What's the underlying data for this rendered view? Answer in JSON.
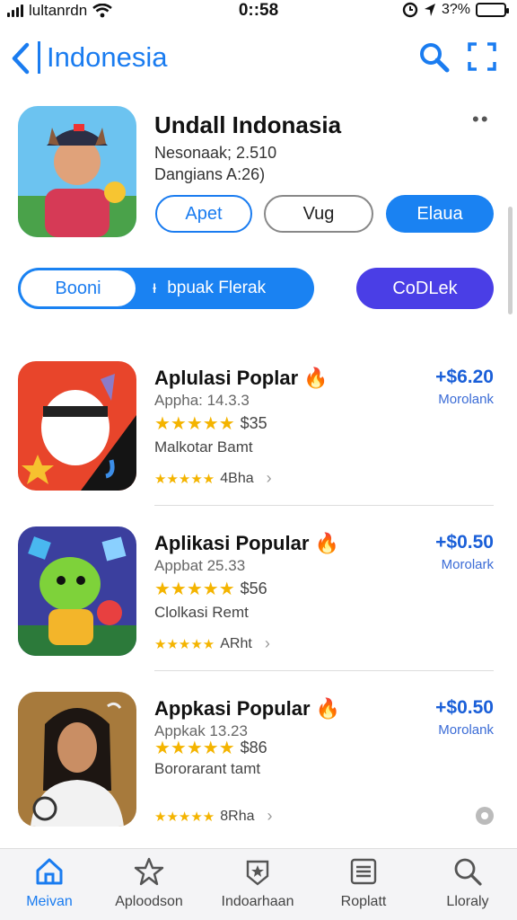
{
  "status": {
    "carrier": "lultanrdn",
    "time": "0::58",
    "battery": "3?%"
  },
  "nav": {
    "title": "Indonesia"
  },
  "header": {
    "title": "Undall Indonasia",
    "sub1": "Nesonaak; 2.510",
    "sub2": "Dangians A:26)",
    "buttons": [
      "Apet",
      "Vug",
      "Elaua"
    ]
  },
  "segment": {
    "active": "Booni",
    "inactive": "bpuak Flerak"
  },
  "cta": "CoDLek",
  "apps": [
    {
      "name": "Aplulasi Poplar",
      "meta": "Appha: 14.3.3",
      "amount": "$35",
      "developer": "Malkotar Bamt",
      "rating": "4Bha",
      "price": "+$6.20",
      "price_label": "Morolank"
    },
    {
      "name": "Aplikasi Popular",
      "meta": "Appbat 25.33",
      "amount": "$56",
      "developer": "Clolkasi Remt",
      "rating": "ARht",
      "price": "+$0.50",
      "price_label": "Morolark"
    },
    {
      "name": "Appkasi Popular",
      "meta": "Appkak 13.23",
      "amount": "$86",
      "developer": "Bororarant tamt",
      "rating": "8Rha",
      "price": "+$0.50",
      "price_label": "Morolank"
    }
  ],
  "tabs": [
    "Meivan",
    "Aploodson",
    "Indoarhaan",
    "Roplatt",
    "Lloraly"
  ],
  "colors": {
    "accent": "#1a7cf0",
    "cta": "#4a3ee6",
    "star": "#f4b400"
  }
}
